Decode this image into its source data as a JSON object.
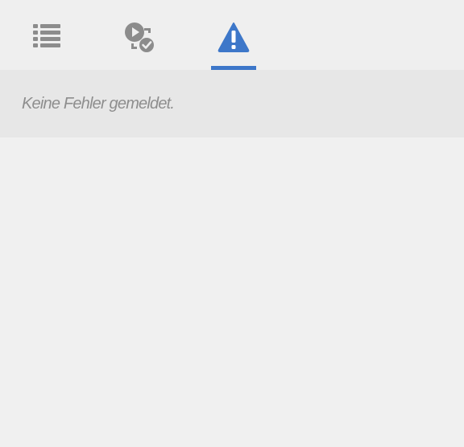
{
  "tabs": [
    {
      "icon": "list-icon",
      "active": false
    },
    {
      "icon": "play-check-icon",
      "active": false
    },
    {
      "icon": "warning-icon",
      "active": true
    }
  ],
  "colors": {
    "accent": "#3d77c9",
    "icon_inactive": "#8c8c8c",
    "message_text": "#8e8e8e",
    "message_bar_bg": "#e7e7e7",
    "panel_bg": "#f0f0f0"
  },
  "messages": {
    "empty_text": "Keine Fehler gemeldet."
  }
}
